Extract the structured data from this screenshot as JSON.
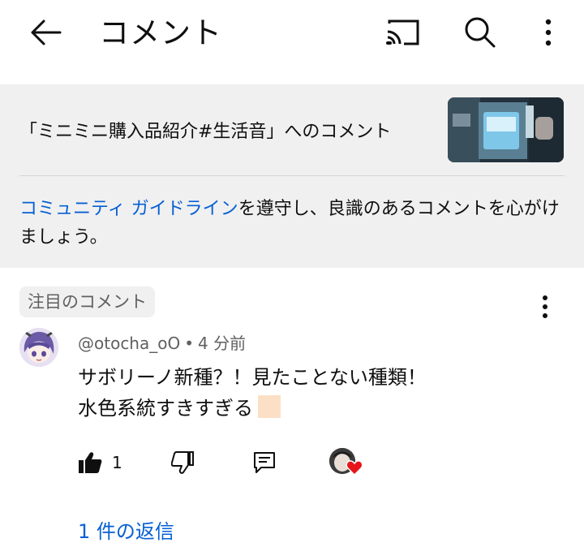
{
  "header": {
    "title": "コメント",
    "icons": [
      "back-arrow-icon",
      "cast-icon",
      "search-icon",
      "more-vert-icon"
    ]
  },
  "video": {
    "comments_for": "「ミニミニ購入品紹介#生活音」へのコメント"
  },
  "guideline": {
    "link_text": "コミュニティ ガイドライン",
    "rest_text": "を遵守し、良識のあるコメントを心がけましょう。"
  },
  "comment": {
    "pinned_label": "注目のコメント",
    "author": "@otocha_oO",
    "separator": "•",
    "time": "4 分前",
    "line1": "サボリーノ新種？！見たことない種類！",
    "line2": "水色系統すきすぎる",
    "like_count": "1",
    "replies_label": "1 件の返信"
  },
  "colors": {
    "accent_link": "#065fd4",
    "panel_bg": "#f0f0f0",
    "heart": "#e8141b"
  }
}
